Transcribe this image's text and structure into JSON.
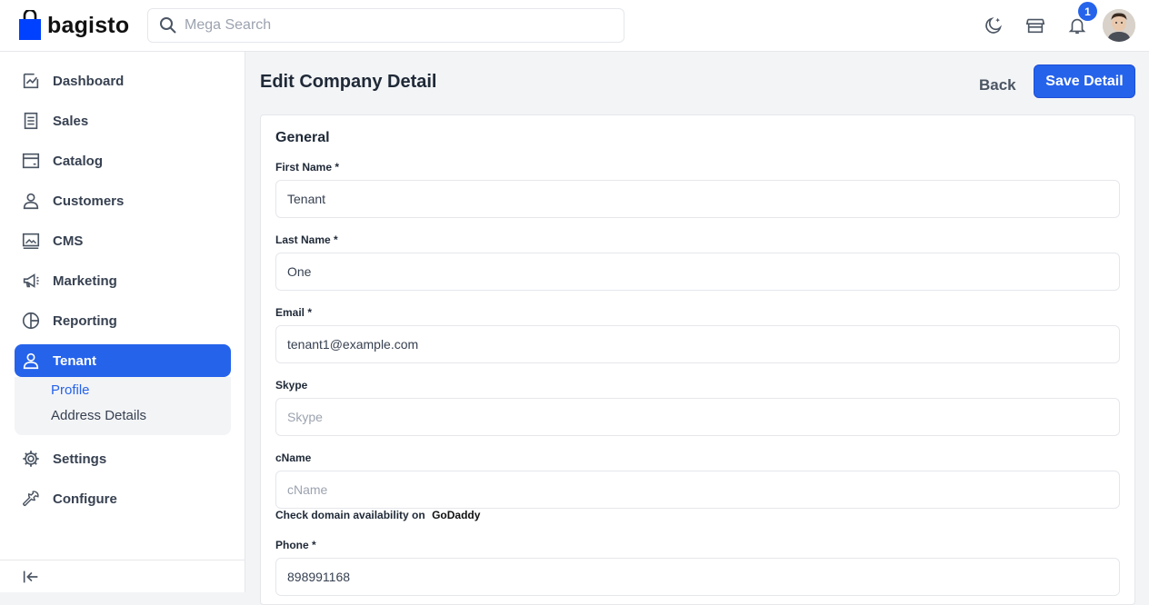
{
  "brand": {
    "name": "bagisto"
  },
  "search": {
    "placeholder": "Mega Search"
  },
  "header": {
    "notification_count": "1"
  },
  "sidebar": {
    "items": [
      {
        "label": "Dashboard",
        "icon": "dashboard-icon"
      },
      {
        "label": "Sales",
        "icon": "sales-icon"
      },
      {
        "label": "Catalog",
        "icon": "catalog-icon"
      },
      {
        "label": "Customers",
        "icon": "customers-icon"
      },
      {
        "label": "CMS",
        "icon": "cms-icon"
      },
      {
        "label": "Marketing",
        "icon": "marketing-icon"
      },
      {
        "label": "Reporting",
        "icon": "reporting-icon"
      },
      {
        "label": "Tenant",
        "icon": "tenant-icon"
      },
      {
        "label": "Settings",
        "icon": "settings-icon"
      },
      {
        "label": "Configure",
        "icon": "configure-icon"
      }
    ],
    "submenu": [
      {
        "label": "Profile"
      },
      {
        "label": "Address Details"
      }
    ]
  },
  "page": {
    "title": "Edit Company Detail",
    "back_label": "Back",
    "save_label": "Save Detail"
  },
  "form": {
    "section_title": "General",
    "first_name": {
      "label": "First Name *",
      "value": "Tenant"
    },
    "last_name": {
      "label": "Last Name *",
      "value": "One"
    },
    "email": {
      "label": "Email *",
      "value": "tenant1@example.com"
    },
    "skype": {
      "label": "Skype",
      "placeholder": "Skype"
    },
    "cname": {
      "label": "cName",
      "placeholder": "cName"
    },
    "domain_hint": {
      "text": "Check domain availability on",
      "link": "GoDaddy"
    },
    "phone": {
      "label": "Phone *",
      "value": "898991168"
    }
  },
  "colors": {
    "accent": "#2563eb",
    "brand_bag": "#0041ff"
  }
}
